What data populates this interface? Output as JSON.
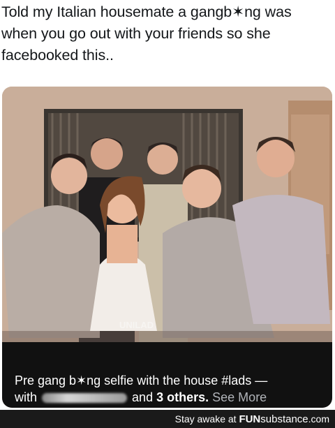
{
  "caption": {
    "line1": "Told my Italian housemate a gangb✶ng was",
    "line2": "when you go out with your friends so she",
    "line3": "facebooked this.."
  },
  "post": {
    "text_line1": "Pre gang b✶ng selfie with the house #lads —",
    "with_label": "with",
    "others_prefix": "and",
    "others_count": "3 others.",
    "see_more": "See More",
    "watermark": "UNILAD"
  },
  "footer": {
    "prefix": "Stay awake at",
    "brand_bold": "FUN",
    "brand_rest": "substance",
    "brand_tld": ".com"
  },
  "colors": {
    "fb_bar": "#111111",
    "footer_bg": "#1a1a1a",
    "see_more": "#b0b3b8"
  }
}
